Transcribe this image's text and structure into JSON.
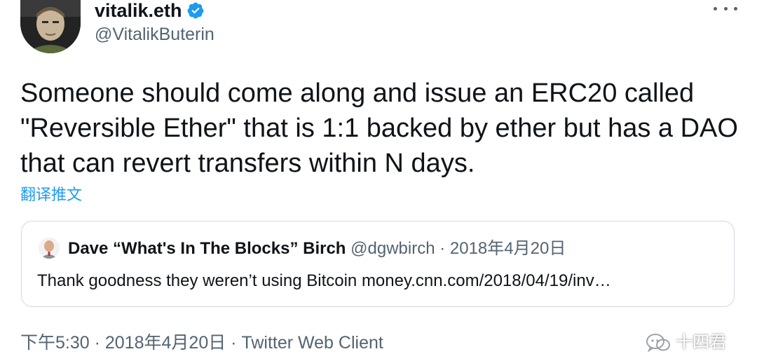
{
  "author": {
    "display_name": "vitalik.eth",
    "handle": "@VitalikButerin"
  },
  "tweet": {
    "text": "Someone should come along and issue an ERC20 called \"Reversible Ether\" that is 1:1 backed by ether but has a DAO that can revert transfers within N days.",
    "translate_label": "翻译推文"
  },
  "quote": {
    "display_name": "Dave “What's In The Blocks” Birch",
    "handle": "@dgwbirch",
    "separator": " · ",
    "date": "2018年4月20日",
    "text": "Thank goodness they weren’t using Bitcoin money.cnn.com/2018/04/19/inv…"
  },
  "footer": {
    "time": "下午5:30",
    "separator": " · ",
    "date": "2018年4月20日",
    "client": "Twitter Web Client"
  },
  "watermark": {
    "text": "十四君"
  },
  "colors": {
    "verified": "#1d9bf0",
    "link": "#1d9bf0",
    "secondary_text": "#536471",
    "border": "#cfd9de"
  },
  "icons": {
    "verified": "verified-badge-icon",
    "more": "more-icon",
    "watermark": "wechat-icon"
  }
}
